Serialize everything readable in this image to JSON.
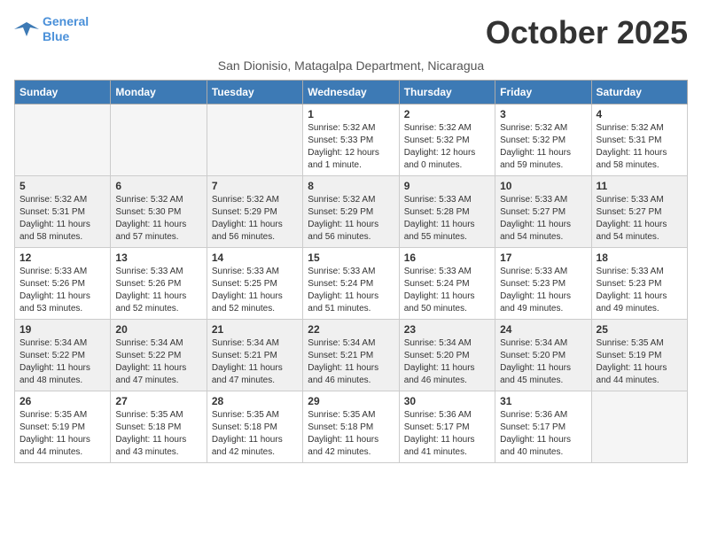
{
  "logo": {
    "line1": "General",
    "line2": "Blue"
  },
  "title": "October 2025",
  "subtitle": "San Dionisio, Matagalpa Department, Nicaragua",
  "days_of_week": [
    "Sunday",
    "Monday",
    "Tuesday",
    "Wednesday",
    "Thursday",
    "Friday",
    "Saturday"
  ],
  "weeks": [
    [
      {
        "day": "",
        "info": ""
      },
      {
        "day": "",
        "info": ""
      },
      {
        "day": "",
        "info": ""
      },
      {
        "day": "1",
        "info": "Sunrise: 5:32 AM\nSunset: 5:33 PM\nDaylight: 12 hours\nand 1 minute."
      },
      {
        "day": "2",
        "info": "Sunrise: 5:32 AM\nSunset: 5:32 PM\nDaylight: 12 hours\nand 0 minutes."
      },
      {
        "day": "3",
        "info": "Sunrise: 5:32 AM\nSunset: 5:32 PM\nDaylight: 11 hours\nand 59 minutes."
      },
      {
        "day": "4",
        "info": "Sunrise: 5:32 AM\nSunset: 5:31 PM\nDaylight: 11 hours\nand 58 minutes."
      }
    ],
    [
      {
        "day": "5",
        "info": "Sunrise: 5:32 AM\nSunset: 5:31 PM\nDaylight: 11 hours\nand 58 minutes."
      },
      {
        "day": "6",
        "info": "Sunrise: 5:32 AM\nSunset: 5:30 PM\nDaylight: 11 hours\nand 57 minutes."
      },
      {
        "day": "7",
        "info": "Sunrise: 5:32 AM\nSunset: 5:29 PM\nDaylight: 11 hours\nand 56 minutes."
      },
      {
        "day": "8",
        "info": "Sunrise: 5:32 AM\nSunset: 5:29 PM\nDaylight: 11 hours\nand 56 minutes."
      },
      {
        "day": "9",
        "info": "Sunrise: 5:33 AM\nSunset: 5:28 PM\nDaylight: 11 hours\nand 55 minutes."
      },
      {
        "day": "10",
        "info": "Sunrise: 5:33 AM\nSunset: 5:27 PM\nDaylight: 11 hours\nand 54 minutes."
      },
      {
        "day": "11",
        "info": "Sunrise: 5:33 AM\nSunset: 5:27 PM\nDaylight: 11 hours\nand 54 minutes."
      }
    ],
    [
      {
        "day": "12",
        "info": "Sunrise: 5:33 AM\nSunset: 5:26 PM\nDaylight: 11 hours\nand 53 minutes."
      },
      {
        "day": "13",
        "info": "Sunrise: 5:33 AM\nSunset: 5:26 PM\nDaylight: 11 hours\nand 52 minutes."
      },
      {
        "day": "14",
        "info": "Sunrise: 5:33 AM\nSunset: 5:25 PM\nDaylight: 11 hours\nand 52 minutes."
      },
      {
        "day": "15",
        "info": "Sunrise: 5:33 AM\nSunset: 5:24 PM\nDaylight: 11 hours\nand 51 minutes."
      },
      {
        "day": "16",
        "info": "Sunrise: 5:33 AM\nSunset: 5:24 PM\nDaylight: 11 hours\nand 50 minutes."
      },
      {
        "day": "17",
        "info": "Sunrise: 5:33 AM\nSunset: 5:23 PM\nDaylight: 11 hours\nand 49 minutes."
      },
      {
        "day": "18",
        "info": "Sunrise: 5:33 AM\nSunset: 5:23 PM\nDaylight: 11 hours\nand 49 minutes."
      }
    ],
    [
      {
        "day": "19",
        "info": "Sunrise: 5:34 AM\nSunset: 5:22 PM\nDaylight: 11 hours\nand 48 minutes."
      },
      {
        "day": "20",
        "info": "Sunrise: 5:34 AM\nSunset: 5:22 PM\nDaylight: 11 hours\nand 47 minutes."
      },
      {
        "day": "21",
        "info": "Sunrise: 5:34 AM\nSunset: 5:21 PM\nDaylight: 11 hours\nand 47 minutes."
      },
      {
        "day": "22",
        "info": "Sunrise: 5:34 AM\nSunset: 5:21 PM\nDaylight: 11 hours\nand 46 minutes."
      },
      {
        "day": "23",
        "info": "Sunrise: 5:34 AM\nSunset: 5:20 PM\nDaylight: 11 hours\nand 46 minutes."
      },
      {
        "day": "24",
        "info": "Sunrise: 5:34 AM\nSunset: 5:20 PM\nDaylight: 11 hours\nand 45 minutes."
      },
      {
        "day": "25",
        "info": "Sunrise: 5:35 AM\nSunset: 5:19 PM\nDaylight: 11 hours\nand 44 minutes."
      }
    ],
    [
      {
        "day": "26",
        "info": "Sunrise: 5:35 AM\nSunset: 5:19 PM\nDaylight: 11 hours\nand 44 minutes."
      },
      {
        "day": "27",
        "info": "Sunrise: 5:35 AM\nSunset: 5:18 PM\nDaylight: 11 hours\nand 43 minutes."
      },
      {
        "day": "28",
        "info": "Sunrise: 5:35 AM\nSunset: 5:18 PM\nDaylight: 11 hours\nand 42 minutes."
      },
      {
        "day": "29",
        "info": "Sunrise: 5:35 AM\nSunset: 5:18 PM\nDaylight: 11 hours\nand 42 minutes."
      },
      {
        "day": "30",
        "info": "Sunrise: 5:36 AM\nSunset: 5:17 PM\nDaylight: 11 hours\nand 41 minutes."
      },
      {
        "day": "31",
        "info": "Sunrise: 5:36 AM\nSunset: 5:17 PM\nDaylight: 11 hours\nand 40 minutes."
      },
      {
        "day": "",
        "info": ""
      }
    ]
  ]
}
